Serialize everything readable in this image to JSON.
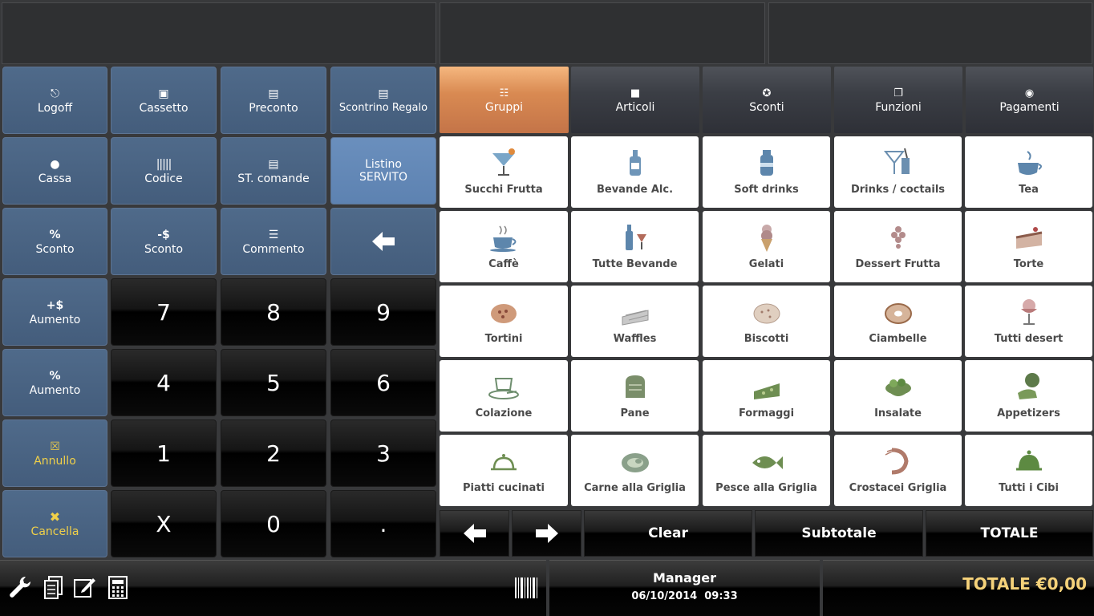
{
  "left_buttons": {
    "logoff": "Logoff",
    "cassetto": "Cassetto",
    "preconto": "Preconto",
    "scontrino_regalo": "Scontrino Regalo",
    "cassa": "Cassa",
    "codice": "Codice",
    "st_comande": "ST. comande",
    "listino_line1": "Listino",
    "listino_line2": "SERVITO",
    "sconto_pct": "Sconto",
    "sconto_val": "Sconto",
    "commento": "Commento",
    "aumento_val": "Aumento",
    "aumento_pct": "Aumento",
    "annullo": "Annullo",
    "cancella": "Cancella"
  },
  "keypad": [
    "7",
    "8",
    "9",
    "4",
    "5",
    "6",
    "1",
    "2",
    "3",
    "X",
    "0",
    "."
  ],
  "tabs": [
    "Gruppi",
    "Articoli",
    "Sconti",
    "Funzioni",
    "Pagamenti"
  ],
  "active_tab": "Gruppi",
  "categories": [
    "Succhi Frutta",
    "Bevande Alc.",
    "Soft drinks",
    "Drinks / coctails",
    "Tea",
    "Caffè",
    "Tutte Bevande",
    "Gelati",
    "Dessert Frutta",
    "Torte",
    "Tortini",
    "Waffles",
    "Biscotti",
    "Ciambelle",
    "Tutti desert",
    "Colazione",
    "Pane",
    "Formaggi",
    "Insalate",
    "Appetizers",
    "Piatti cucinati",
    "Carne alla Griglia",
    "Pesce alla Griglia",
    "Crostacei Griglia",
    "Tutti i Cibi"
  ],
  "actions": {
    "clear": "Clear",
    "subtotale": "Subtotale",
    "totale": "TOTALE"
  },
  "status": {
    "user": "Manager",
    "datetime": "06/10/2014  09:33",
    "total": "TOTALE €0,00"
  },
  "colors": {
    "accent_blue": "#4f6a8a",
    "active_blue": "#6a8fbd",
    "active_tab": "#d98a52",
    "yellow": "#f0d049",
    "total_gold": "#f5d27a"
  }
}
